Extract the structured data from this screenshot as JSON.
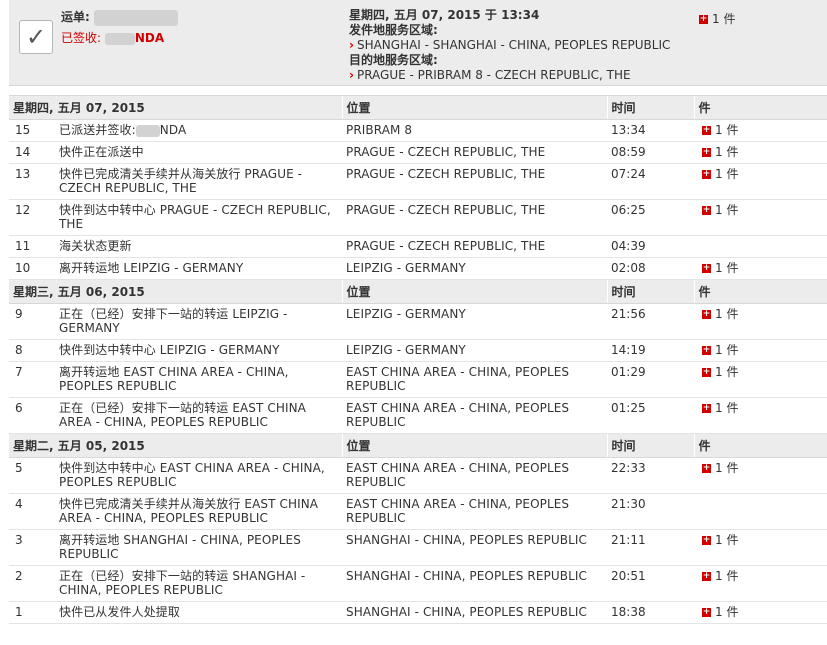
{
  "summary": {
    "waybill_label": "运单:",
    "status_label": "已签收:",
    "status_name_tail": "NDA",
    "date_time": "星期四, 五月 07, 2015 于 13:34",
    "origin_label": "发件地服务区域:",
    "origin": "SHANGHAI - SHANGHAI - CHINA, PEOPLES REPUBLIC",
    "dest_label": "目的地服务区域:",
    "dest": "PRAGUE - PRIBRAM 8 - CZECH REPUBLIC, THE",
    "pieces": "1 件",
    "check_glyph": "✓",
    "chevron_glyph": "›",
    "piece_icon_glyph": "+"
  },
  "columns": {
    "location": "位置",
    "time": "时间",
    "pieces": "件"
  },
  "days": [
    {
      "date": "星期四, 五月 07, 2015",
      "events": [
        {
          "num": "15",
          "desc": "已派送并签收:",
          "desc_tail": "NDA",
          "redacted": true,
          "loc": "PRIBRAM 8",
          "time": "13:34",
          "pieces": "1 件"
        },
        {
          "num": "14",
          "desc": "快件正在派送中",
          "loc": "PRAGUE - CZECH REPUBLIC, THE",
          "time": "08:59",
          "pieces": "1 件"
        },
        {
          "num": "13",
          "desc": "快件已完成清关手续并从海关放行 PRAGUE - CZECH REPUBLIC, THE",
          "loc": "PRAGUE - CZECH REPUBLIC, THE",
          "time": "07:24",
          "pieces": "1 件"
        },
        {
          "num": "12",
          "desc": "快件到达中转中心 PRAGUE - CZECH REPUBLIC, THE",
          "loc": "PRAGUE - CZECH REPUBLIC, THE",
          "time": "06:25",
          "pieces": "1 件"
        },
        {
          "num": "11",
          "desc": "海关状态更新",
          "loc": "PRAGUE - CZECH REPUBLIC, THE",
          "time": "04:39",
          "pieces": ""
        },
        {
          "num": "10",
          "desc": "离开转运地 LEIPZIG - GERMANY",
          "loc": "LEIPZIG - GERMANY",
          "time": "02:08",
          "pieces": "1 件"
        }
      ]
    },
    {
      "date": "星期三, 五月 06, 2015",
      "events": [
        {
          "num": "9",
          "desc": "正在（已经）安排下一站的转运 LEIPZIG - GERMANY",
          "loc": "LEIPZIG - GERMANY",
          "time": "21:56",
          "pieces": "1 件"
        },
        {
          "num": "8",
          "desc": "快件到达中转中心 LEIPZIG - GERMANY",
          "loc": "LEIPZIG - GERMANY",
          "time": "14:19",
          "pieces": "1 件"
        },
        {
          "num": "7",
          "desc": "离开转运地 EAST CHINA AREA - CHINA, PEOPLES REPUBLIC",
          "loc": "EAST CHINA AREA - CHINA, PEOPLES REPUBLIC",
          "time": "01:29",
          "pieces": "1 件"
        },
        {
          "num": "6",
          "desc": "正在（已经）安排下一站的转运 EAST CHINA AREA - CHINA, PEOPLES REPUBLIC",
          "loc": "EAST CHINA AREA - CHINA, PEOPLES REPUBLIC",
          "time": "01:25",
          "pieces": "1 件"
        }
      ]
    },
    {
      "date": "星期二, 五月 05, 2015",
      "events": [
        {
          "num": "5",
          "desc": "快件到达中转中心 EAST CHINA AREA - CHINA, PEOPLES REPUBLIC",
          "loc": "EAST CHINA AREA - CHINA, PEOPLES REPUBLIC",
          "time": "22:33",
          "pieces": "1 件"
        },
        {
          "num": "4",
          "desc": "快件已完成清关手续并从海关放行 EAST CHINA AREA - CHINA, PEOPLES REPUBLIC",
          "loc": "EAST CHINA AREA - CHINA, PEOPLES REPUBLIC",
          "time": "21:30",
          "pieces": ""
        },
        {
          "num": "3",
          "desc": "离开转运地 SHANGHAI - CHINA, PEOPLES REPUBLIC",
          "loc": "SHANGHAI - CHINA, PEOPLES REPUBLIC",
          "time": "21:11",
          "pieces": "1 件"
        },
        {
          "num": "2",
          "desc": "正在（已经）安排下一站的转运 SHANGHAI - CHINA, PEOPLES REPUBLIC",
          "loc": "SHANGHAI - CHINA, PEOPLES REPUBLIC",
          "time": "20:51",
          "pieces": "1 件"
        },
        {
          "num": "1",
          "desc": "快件已从发件人处提取",
          "loc": "SHANGHAI - CHINA, PEOPLES REPUBLIC",
          "time": "18:38",
          "pieces": "1 件"
        }
      ]
    }
  ]
}
